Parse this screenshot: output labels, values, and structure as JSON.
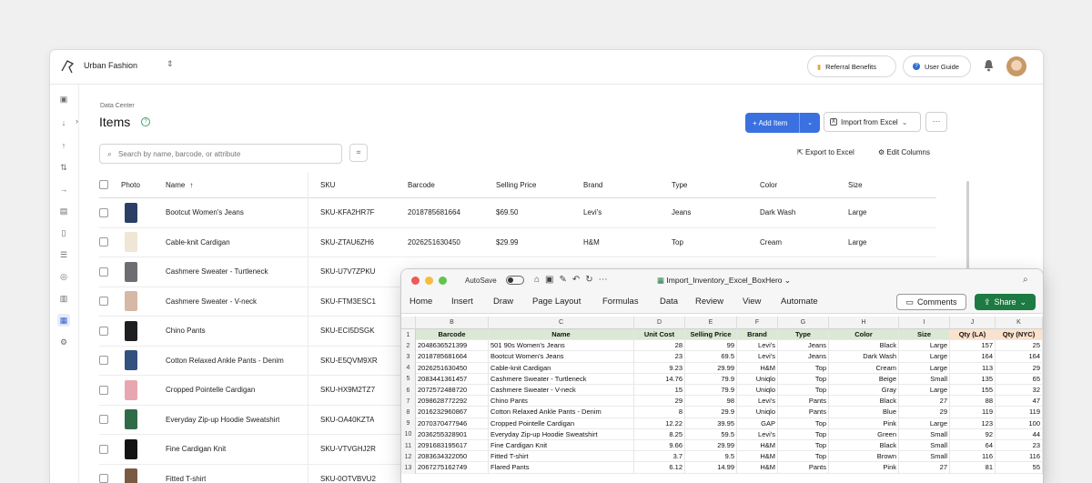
{
  "app": {
    "org_name": "Urban Fashion",
    "referral_label": "Referral Benefits",
    "guide_label": "User Guide"
  },
  "page": {
    "breadcrumb": "Data Center",
    "title": "Items",
    "add_label": "Add Item",
    "import_label": "Import from Excel",
    "more_label": "···",
    "search_placeholder": "Search by name, barcode, or attribute",
    "export_label": "Export to Excel",
    "edit_columns_label": "Edit Columns"
  },
  "table": {
    "headers": {
      "photo": "Photo",
      "name": "Name",
      "sku": "SKU",
      "barcode": "Barcode",
      "price": "Selling Price",
      "brand": "Brand",
      "type": "Type",
      "color": "Color",
      "size": "Size"
    },
    "rows": [
      {
        "name": "Bootcut Women's Jeans",
        "sku": "SKU-KFA2HR7F",
        "barcode": "2018785681664",
        "price": "$69.50",
        "brand": "Levi's",
        "type": "Jeans",
        "color": "Dark Wash",
        "size": "Large",
        "thumb": "#2b3f66"
      },
      {
        "name": "Cable-knit Cardigan",
        "sku": "SKU-ZTAU6ZH6",
        "barcode": "2026251630450",
        "price": "$29.99",
        "brand": "H&M",
        "type": "Top",
        "color": "Cream",
        "size": "Large",
        "thumb": "#efe6d6"
      },
      {
        "name": "Cashmere Sweater - Turtleneck",
        "sku": "SKU-U7V7ZPKU",
        "barcode": "2083441361457",
        "price": "$79.90",
        "brand": "Uniqlo",
        "type": "Top",
        "color": "Beige",
        "size": "Small",
        "thumb": "#6e6e72"
      },
      {
        "name": "Cashmere Sweater - V-neck",
        "sku": "SKU-FTM3ESC1",
        "barcode": "",
        "price": "",
        "brand": "",
        "type": "",
        "color": "",
        "size": "",
        "thumb": "#d6b8a6"
      },
      {
        "name": "Chino Pants",
        "sku": "SKU-ECI5DSGK",
        "barcode": "",
        "price": "",
        "brand": "",
        "type": "",
        "color": "",
        "size": "",
        "thumb": "#1f1f22"
      },
      {
        "name": "Cotton Relaxed Ankle Pants - Denim",
        "sku": "SKU-E5QVM9XR",
        "barcode": "",
        "price": "",
        "brand": "",
        "type": "",
        "color": "",
        "size": "",
        "thumb": "#34507e"
      },
      {
        "name": "Cropped Pointelle Cardigan",
        "sku": "SKU-HX9M2TZ7",
        "barcode": "",
        "price": "",
        "brand": "",
        "type": "",
        "color": "",
        "size": "",
        "thumb": "#e8a7b0"
      },
      {
        "name": "Everyday Zip-up Hoodie Sweatshirt",
        "sku": "SKU-OA40KZTA",
        "barcode": "",
        "price": "",
        "brand": "",
        "type": "",
        "color": "",
        "size": "",
        "thumb": "#2f6b47"
      },
      {
        "name": "Fine Cardigan Knit",
        "sku": "SKU-VTVGHJ2R",
        "barcode": "",
        "price": "",
        "brand": "",
        "type": "",
        "color": "",
        "size": "",
        "thumb": "#141414"
      },
      {
        "name": "Fitted T-shirt",
        "sku": "SKU-0OTVBVU2",
        "barcode": "",
        "price": "",
        "brand": "",
        "type": "",
        "color": "",
        "size": "",
        "thumb": "#7a5a45"
      }
    ]
  },
  "excel": {
    "autosave_label": "AutoSave",
    "file_name": "Import_Inventory_Excel_BoxHero",
    "tabs": [
      "Home",
      "Insert",
      "Draw",
      "Page Layout",
      "Formulas",
      "Data",
      "Review",
      "View",
      "Automate"
    ],
    "comments_label": "Comments",
    "share_label": "Share",
    "col_letters": [
      "B",
      "C",
      "D",
      "E",
      "F",
      "G",
      "H",
      "I",
      "J",
      "K"
    ],
    "header_row": [
      "Barcode",
      "Name",
      "Unit Cost",
      "Selling Price",
      "Brand",
      "Type",
      "Color",
      "Size",
      "Qty (LA)",
      "Qty (NYC)"
    ],
    "rows": [
      [
        "2048636521399",
        "501 90s Women's Jeans",
        "28",
        "99",
        "Levi's",
        "Jeans",
        "Black",
        "Large",
        "157",
        "25"
      ],
      [
        "2018785681664",
        "Bootcut Women's Jeans",
        "23",
        "69.5",
        "Levi's",
        "Jeans",
        "Dark Wash",
        "Large",
        "164",
        "164"
      ],
      [
        "2026251630450",
        "Cable-knit Cardigan",
        "9.23",
        "29.99",
        "H&M",
        "Top",
        "Cream",
        "Large",
        "113",
        "29"
      ],
      [
        "2083441361457",
        "Cashmere Sweater - Turtleneck",
        "14.76",
        "79.9",
        "Uniqlo",
        "Top",
        "Beige",
        "Small",
        "135",
        "65"
      ],
      [
        "2072572488720",
        "Cashmere Sweater - V-neck",
        "15",
        "79.9",
        "Uniqlo",
        "Top",
        "Gray",
        "Large",
        "155",
        "32"
      ],
      [
        "2098628772292",
        "Chino Pants",
        "29",
        "98",
        "Levi's",
        "Pants",
        "Black",
        "27",
        "88",
        "47"
      ],
      [
        "2016232960867",
        "Cotton Relaxed Ankle Pants - Denim",
        "8",
        "29.9",
        "Uniqlo",
        "Pants",
        "Blue",
        "29",
        "119",
        "119"
      ],
      [
        "2070370477946",
        "Cropped Pointelle Cardigan",
        "12.22",
        "39.95",
        "GAP",
        "Top",
        "Pink",
        "Large",
        "123",
        "100"
      ],
      [
        "2036255328901",
        "Everyday Zip-up Hoodie Sweatshirt",
        "8.25",
        "59.5",
        "Levi's",
        "Top",
        "Green",
        "Small",
        "92",
        "44"
      ],
      [
        "2091683195617",
        "Fine Cardigan Knit",
        "9.66",
        "29.99",
        "H&M",
        "Top",
        "Black",
        "Small",
        "64",
        "23"
      ],
      [
        "2083634322050",
        "Fitted T-shirt",
        "3.7",
        "9.5",
        "H&M",
        "Top",
        "Brown",
        "Small",
        "116",
        "116"
      ],
      [
        "2067275162749",
        "Flared Pants",
        "6.12",
        "14.99",
        "H&M",
        "Pants",
        "Pink",
        "27",
        "81",
        "55"
      ]
    ]
  }
}
